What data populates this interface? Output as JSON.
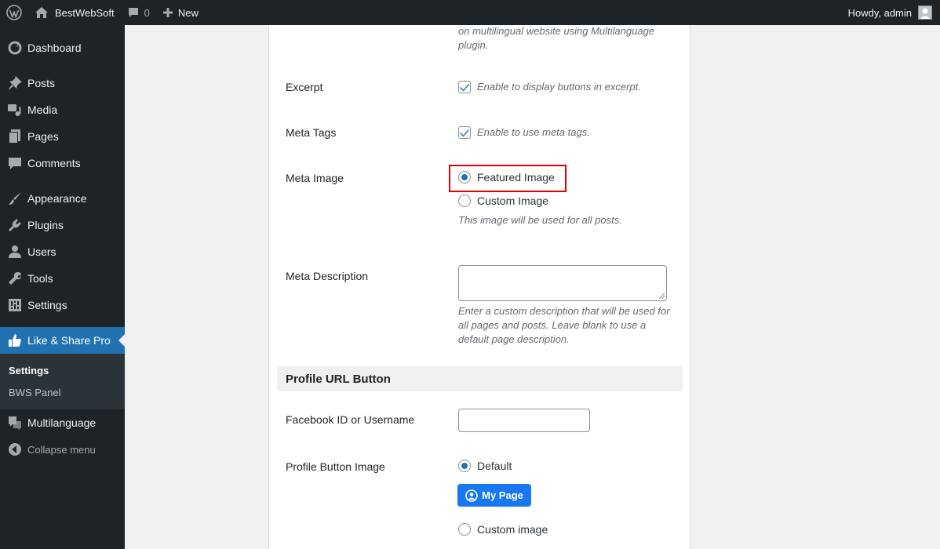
{
  "adminbar": {
    "site_name": "BestWebSoft",
    "comments_count": "0",
    "new_label": "New",
    "greeting": "Howdy, admin"
  },
  "sidebar": {
    "items": [
      {
        "label": "Dashboard",
        "icon": "dashboard-icon"
      },
      {
        "label": "Posts",
        "icon": "pin-icon"
      },
      {
        "label": "Media",
        "icon": "media-icon"
      },
      {
        "label": "Pages",
        "icon": "pages-icon"
      },
      {
        "label": "Comments",
        "icon": "comment-icon"
      },
      {
        "label": "Appearance",
        "icon": "brush-icon"
      },
      {
        "label": "Plugins",
        "icon": "plug-icon"
      },
      {
        "label": "Users",
        "icon": "user-icon"
      },
      {
        "label": "Tools",
        "icon": "wrench-icon"
      },
      {
        "label": "Settings",
        "icon": "sliders-icon"
      },
      {
        "label": "Like & Share Pro",
        "icon": "thumbs-up-icon"
      },
      {
        "label": "Multilanguage",
        "icon": "translate-icon"
      }
    ],
    "submenu": [
      "Settings",
      "BWS Panel"
    ],
    "collapse_label": "Collapse menu"
  },
  "settings": {
    "top_desc": "on multilingual website using Multilanguage plugin.",
    "excerpt": {
      "label": "Excerpt",
      "desc": "Enable to display buttons in excerpt.",
      "checked": true
    },
    "meta_tags": {
      "label": "Meta Tags",
      "desc": "Enable to use meta tags.",
      "checked": true
    },
    "meta_image": {
      "label": "Meta Image",
      "options": [
        "Featured Image",
        "Custom Image"
      ],
      "selected": "Featured Image",
      "desc": "This image will be used for all posts."
    },
    "meta_description": {
      "label": "Meta Description",
      "value": "",
      "desc": "Enter a custom description that will be used for all pages and posts. Leave blank to use a default page description."
    },
    "profile_section": {
      "title": "Profile URL Button"
    },
    "facebook_id": {
      "label": "Facebook ID or Username",
      "value": ""
    },
    "profile_image": {
      "label": "Profile Button Image",
      "options": [
        "Default",
        "Custom image"
      ],
      "selected": "Default",
      "button_label": "My Page"
    }
  },
  "colors": {
    "accent": "#2271b1",
    "facebook_blue": "#1877f2",
    "highlight_border": "#e00000"
  }
}
